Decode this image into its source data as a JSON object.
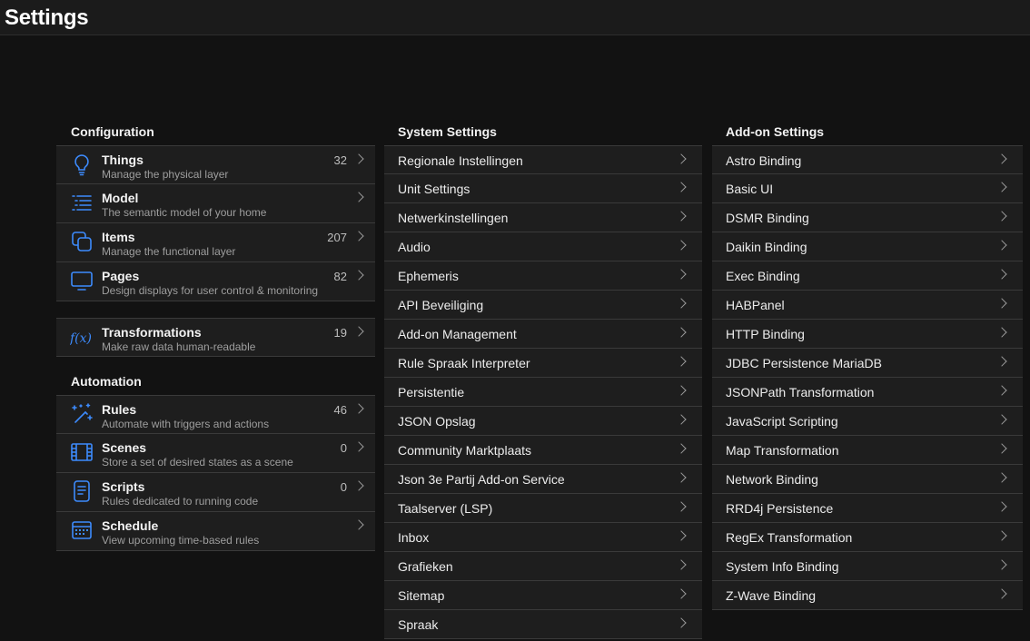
{
  "page": {
    "title": "Settings"
  },
  "configuration": {
    "title": "Configuration",
    "items": [
      {
        "label": "Things",
        "desc": "Manage the physical layer",
        "count": "32"
      },
      {
        "label": "Model",
        "desc": "The semantic model of your home",
        "count": ""
      },
      {
        "label": "Items",
        "desc": "Manage the functional layer",
        "count": "207"
      },
      {
        "label": "Pages",
        "desc": "Design displays for user control & monitoring",
        "count": "82"
      }
    ],
    "transformations": {
      "label": "Transformations",
      "desc": "Make raw data human-readable",
      "count": "19",
      "icon": "f(x)"
    }
  },
  "automation": {
    "title": "Automation",
    "items": [
      {
        "label": "Rules",
        "desc": "Automate with triggers and actions",
        "count": "46"
      },
      {
        "label": "Scenes",
        "desc": "Store a set of desired states as a scene",
        "count": "0"
      },
      {
        "label": "Scripts",
        "desc": "Rules dedicated to running code",
        "count": "0"
      },
      {
        "label": "Schedule",
        "desc": "View upcoming time-based rules",
        "count": ""
      }
    ]
  },
  "system": {
    "title": "System Settings",
    "items": [
      "Regionale Instellingen",
      "Unit Settings",
      "Netwerkinstellingen",
      "Audio",
      "Ephemeris",
      "API Beveiliging",
      "Add-on Management",
      "Rule Spraak Interpreter",
      "Persistentie",
      "JSON Opslag",
      "Community Marktplaats",
      "Json 3e Partij Add-on Service",
      "Taalserver (LSP)",
      "Inbox",
      "Grafieken",
      "Sitemap",
      "Spraak"
    ]
  },
  "addons": {
    "title": "Add-on Settings",
    "items": [
      "Astro Binding",
      "Basic UI",
      "DSMR Binding",
      "Daikin Binding",
      "Exec Binding",
      "HABPanel",
      "HTTP Binding",
      "JDBC Persistence MariaDB",
      "JSONPath Transformation",
      "JavaScript Scripting",
      "Map Transformation",
      "Network Binding",
      "RRD4j Persistence",
      "RegEx Transformation",
      "System Info Binding",
      "Z-Wave Binding"
    ]
  },
  "colors": {
    "accent": "#3d8bfd",
    "background": "#121212",
    "list_bg": "#1e1e1e",
    "divider": "#3a3a3a"
  }
}
